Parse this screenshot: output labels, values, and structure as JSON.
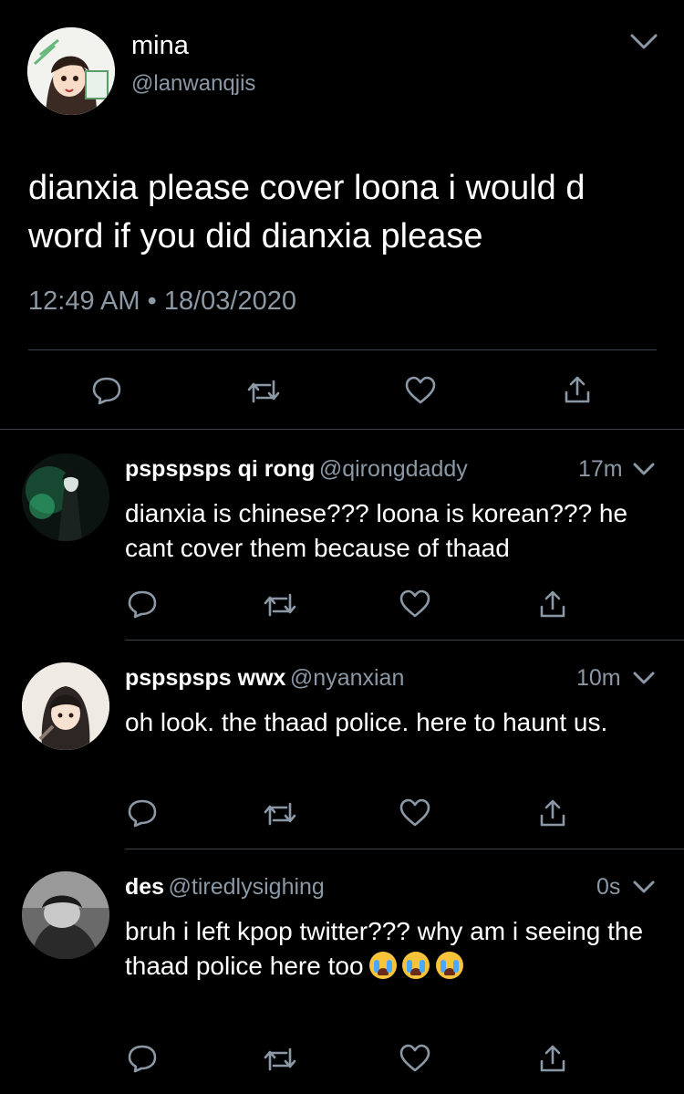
{
  "main_tweet": {
    "author_name": "mina",
    "author_handle": "@lanwanqjis",
    "text": "dianxia please cover loona i would d word if you did dianxia please",
    "timestamp": "12:49 AM",
    "dot": "•",
    "date": "18/03/2020"
  },
  "replies": [
    {
      "name": "pspspsps qi rong",
      "handle": "@qirongdaddy",
      "time": "17m",
      "text": "dianxia is chinese??? loona is korean??? he cant cover them because of thaad"
    },
    {
      "name": "pspspsps wwx",
      "handle": "@nyanxian",
      "time": "10m",
      "text": "oh look. the thaad police. here to haunt us."
    },
    {
      "name": "des",
      "handle": "@tiredlysighing",
      "time": "0s",
      "text": "bruh i left kpop twitter??? why am i seeing the thaad police here too",
      "emojis": [
        "loudly-crying-face",
        "loudly-crying-face",
        "loudly-crying-face"
      ]
    }
  ],
  "icons": [
    "chevron-down-icon",
    "reply-icon",
    "retweet-icon",
    "like-icon",
    "share-icon"
  ],
  "colors": {
    "background": "#000000",
    "text": "#ffffff",
    "muted": "#8b98a5",
    "divider": "#38444d"
  }
}
